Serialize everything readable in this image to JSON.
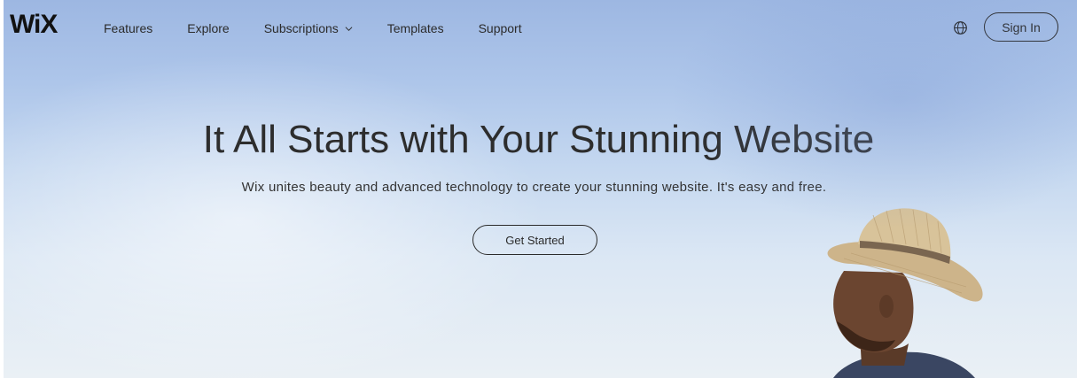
{
  "brand": {
    "logo_text": "WiX"
  },
  "nav": {
    "items": [
      {
        "label": "Features"
      },
      {
        "label": "Explore"
      },
      {
        "label": "Subscriptions",
        "has_dropdown": true
      },
      {
        "label": "Templates"
      },
      {
        "label": "Support"
      }
    ]
  },
  "header": {
    "language_icon": "globe-icon",
    "signin_label": "Sign In"
  },
  "hero": {
    "headline": "It All Starts with Your Stunning Website",
    "subheadline": "Wix unites beauty and advanced technology to create your stunning website. It's easy and free.",
    "cta_label": "Get Started",
    "image_subject": "person-in-straw-hat"
  },
  "colors": {
    "sky_top": "#9db7e2",
    "sky_bottom": "#eaf0f5",
    "text": "#2b2b2b"
  }
}
